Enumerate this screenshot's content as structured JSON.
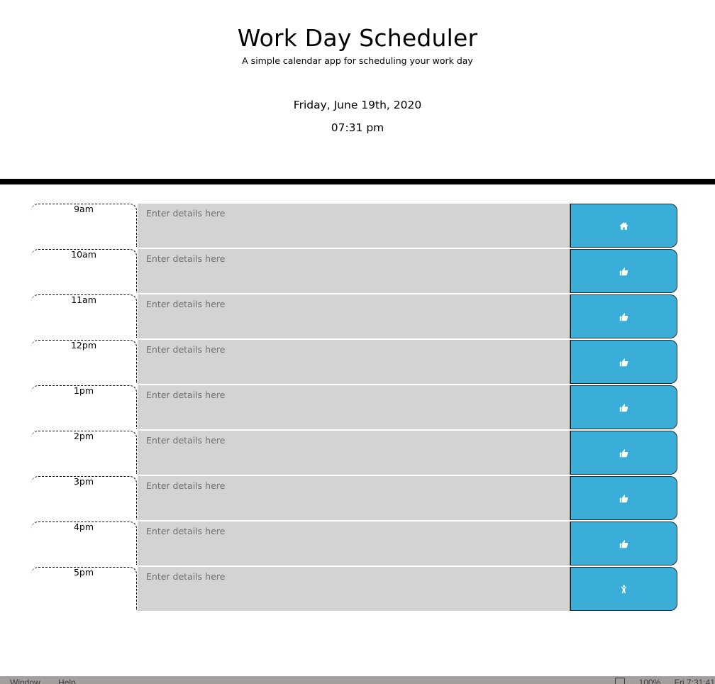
{
  "header": {
    "title": "Work Day Scheduler",
    "subtitle": "A simple calendar app for scheduling your work day",
    "date": "Friday, June 19th, 2020",
    "time": "07:31 pm"
  },
  "schedule": {
    "placeholder": "Enter details here",
    "rows": [
      {
        "hour": "9am",
        "icon": "home-icon"
      },
      {
        "hour": "10am",
        "icon": "thumbs-up-icon"
      },
      {
        "hour": "11am",
        "icon": "thumbs-up-icon"
      },
      {
        "hour": "12pm",
        "icon": "thumbs-up-icon"
      },
      {
        "hour": "1pm",
        "icon": "thumbs-up-icon"
      },
      {
        "hour": "2pm",
        "icon": "thumbs-up-icon"
      },
      {
        "hour": "3pm",
        "icon": "thumbs-up-icon"
      },
      {
        "hour": "4pm",
        "icon": "thumbs-up-icon"
      },
      {
        "hour": "5pm",
        "icon": "person-icon"
      }
    ]
  },
  "colors": {
    "save_button": "#3aaed8",
    "textarea_bg": "#d3d3d3",
    "divider": "#000000"
  },
  "taskbar": {
    "menu": [
      "Window",
      "Help"
    ],
    "battery": "100%",
    "clock": "Fri 7:31:41"
  }
}
